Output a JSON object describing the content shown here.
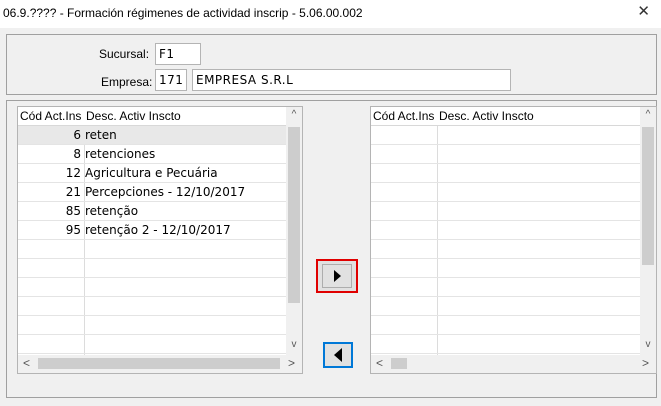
{
  "window": {
    "title": "06.9.???? - Formación régimenes de actividad inscrip - 5.06.00.002",
    "close_glyph": "✕"
  },
  "form": {
    "sucursal_label": "Sucursal:",
    "sucursal_value": "F1",
    "empresa_label": "Empresa:",
    "empresa_code": "171",
    "empresa_name": "EMPRESA  S.R.L"
  },
  "left_grid": {
    "columns": [
      "Cód Act.Ins",
      "Desc. Activ Inscto"
    ],
    "rows": [
      {
        "code": "6",
        "desc": "reten"
      },
      {
        "code": "8",
        "desc": "retenciones"
      },
      {
        "code": "12",
        "desc": "Agricultura e Pecuária"
      },
      {
        "code": "21",
        "desc": "Percepciones - 12/10/2017"
      },
      {
        "code": "85",
        "desc": "retenção"
      },
      {
        "code": "95",
        "desc": "retenção 2 - 12/10/2017"
      }
    ]
  },
  "right_grid": {
    "columns": [
      "Cód Act.Ins",
      "Desc. Activ Inscto"
    ]
  },
  "icons": {
    "scroll_up": "^",
    "scroll_down": "v",
    "scroll_left": "<",
    "scroll_right": ">",
    "move_right": "triangle-right-icon",
    "move_left": "triangle-left-icon"
  }
}
